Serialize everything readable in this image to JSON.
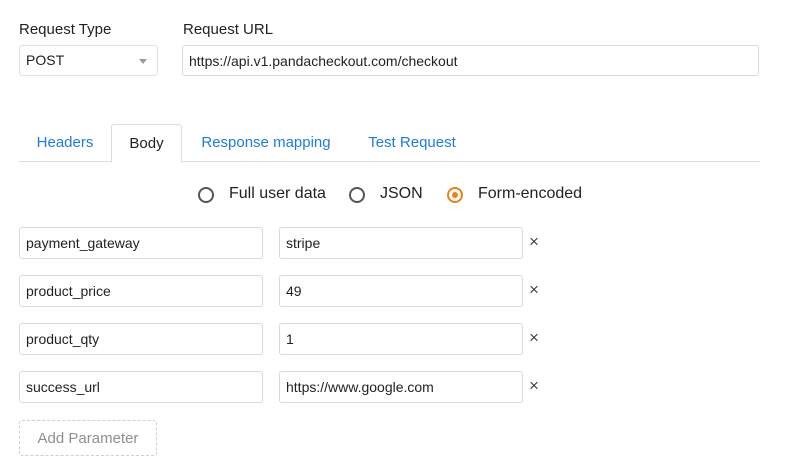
{
  "request": {
    "type_label": "Request Type",
    "type_value": "POST",
    "url_label": "Request URL",
    "url_value": "https://api.v1.pandacheckout.com/checkout"
  },
  "tabs": [
    {
      "label": "Headers",
      "active": false
    },
    {
      "label": "Body",
      "active": true
    },
    {
      "label": "Response mapping",
      "active": false
    },
    {
      "label": "Test Request",
      "active": false
    }
  ],
  "body_format": {
    "options": [
      {
        "label": "Full user data",
        "checked": false
      },
      {
        "label": "JSON",
        "checked": false
      },
      {
        "label": "Form-encoded",
        "checked": true
      }
    ]
  },
  "parameters": [
    {
      "key": "payment_gateway",
      "value": "stripe",
      "remove_icon": "×"
    },
    {
      "key": "product_price",
      "value": "49",
      "remove_icon": "×"
    },
    {
      "key": "product_qty",
      "value": "1",
      "remove_icon": "×"
    },
    {
      "key": "success_url",
      "value": "https://www.google.com",
      "remove_icon": "×"
    }
  ],
  "add_parameter_label": "Add Parameter",
  "colors": {
    "link": "#1f7dd6",
    "radio_checked": "#e8821c",
    "border": "#d9d9d9"
  },
  "icons": {
    "remove": "close-icon",
    "select": "chevron-down-icon"
  }
}
